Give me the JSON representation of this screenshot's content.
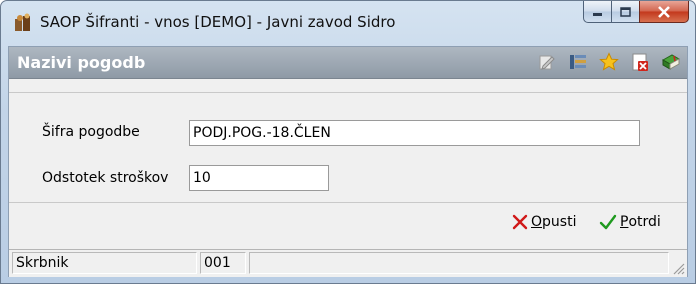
{
  "window": {
    "title": "SAOP Šifranti - vnos [DEMO] - Javni zavod Sidro"
  },
  "header": {
    "title": "Nazivi pogodb",
    "toolbar_icons": [
      "edit-icon",
      "list-view-icon",
      "star-icon",
      "delete-icon",
      "book-icon"
    ]
  },
  "form": {
    "sifra": {
      "label": "Šifra pogodbe",
      "value": "PODJ.POG.-18.ČLEN"
    },
    "odstotek": {
      "label": "Odstotek stroškov",
      "value": "10"
    }
  },
  "actions": {
    "cancel": {
      "accesskey": "O",
      "rest": "pusti"
    },
    "confirm": {
      "accesskey": "P",
      "rest": "otrdi"
    }
  },
  "status": {
    "user": "Skrbnik",
    "code": "001",
    "extra": ""
  }
}
